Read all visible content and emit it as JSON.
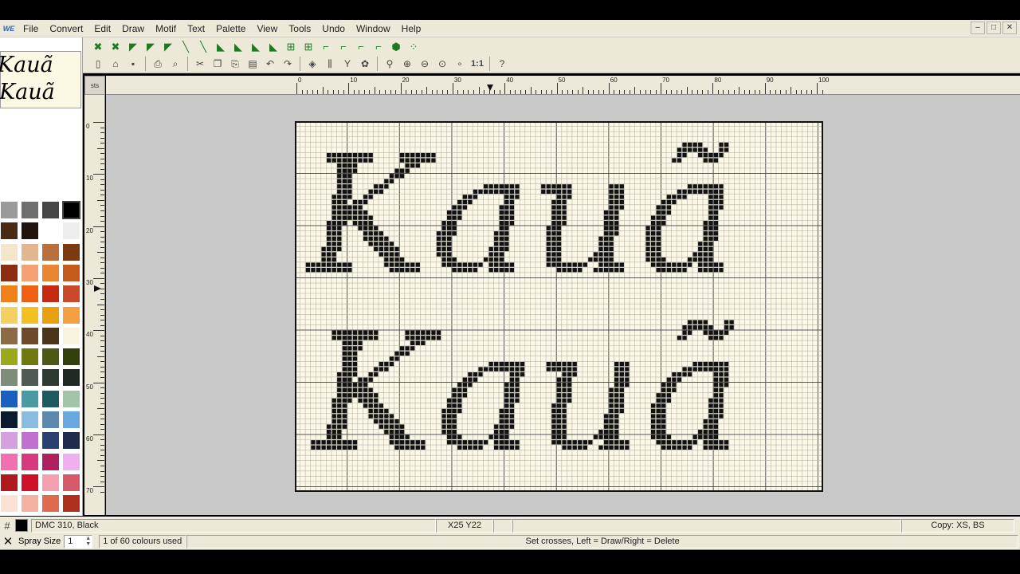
{
  "menu": [
    "File",
    "Convert",
    "Edit",
    "Draw",
    "Motif",
    "Text",
    "Palette",
    "View",
    "Tools",
    "Undo",
    "Window",
    "Help"
  ],
  "app_icon": "WE",
  "window_controls": [
    "–",
    "□",
    "✕"
  ],
  "preview": {
    "line1": "Kauã",
    "line2": "Kauã"
  },
  "ruler": {
    "corner": "sts",
    "top_labels": [
      "0",
      "10",
      "20",
      "30",
      "40",
      "50",
      "60",
      "70",
      "80",
      "90",
      "100"
    ],
    "left_labels": [
      "0",
      "10",
      "20",
      "30",
      "40",
      "50",
      "60",
      "70"
    ]
  },
  "pattern": {
    "text": "Kauã",
    "thread_color": "#111111",
    "fabric_color": "#fbf8e8"
  },
  "palette": [
    "#9a9a9a",
    "#6e6e6e",
    "#454545",
    "#000000",
    "#4a2a12",
    "#22140c",
    "#ffffff",
    "#eeeeee",
    "#f4e6cc",
    "#e2b690",
    "#b9703a",
    "#7b3a10",
    "#8c2c10",
    "#f4a070",
    "#e98632",
    "#c45a1c",
    "#f08018",
    "#f06010",
    "#c42a10",
    "#c84a2a",
    "#f4d060",
    "#f4c020",
    "#e8a010",
    "#f4a040",
    "#8b6a44",
    "#6e4a2a",
    "#4c3418",
    "#fbf4dc",
    "#9aa81a",
    "#6e7a10",
    "#4a5a12",
    "#34400c",
    "#7e8c7a",
    "#4e5a52",
    "#2e3a32",
    "#1e2a22",
    "#1a60c0",
    "#4a9aa4",
    "#1e5a60",
    "#a4c4a8",
    "#0c1a30",
    "#8abce0",
    "#5a8ab0",
    "#6aa8e0",
    "#d4a0e0",
    "#c070d0",
    "#2a4070",
    "#1e2a4c",
    "#f070b0",
    "#d83880",
    "#b02060",
    "#f0b0f0",
    "#b01820",
    "#d01028",
    "#f4a0b0",
    "#d85a6a",
    "#fbe0d4",
    "#f4b0a0",
    "#e06a50",
    "#b03020"
  ],
  "status": {
    "color_name": "DMC 310, Black",
    "coords": "X25 Y22",
    "copy_mode": "Copy: XS, BS",
    "spray_label": "Spray Size",
    "spray_value": "1",
    "colours_used": "1 of 60 colours used",
    "hint": "Set crosses,  Left = Draw/Right = Delete"
  },
  "toolbar1_icons": [
    "cross-icon",
    "cross-icon",
    "half-stitch-icon",
    "half-stitch-icon",
    "half-stitch-icon",
    "backstitch-icon",
    "backstitch-icon",
    "quarter-icon",
    "quarter-icon",
    "quarter-icon",
    "quarter-icon",
    "fill-icon",
    "fill-icon",
    "corner-icon",
    "corner-icon",
    "corner-icon",
    "corner-icon",
    "bead-icon",
    "french-knot-icon"
  ],
  "toolbar2_icons": [
    "new-icon",
    "open-icon",
    "save-icon",
    "|",
    "print-icon",
    "print-preview-icon",
    "|",
    "cut-icon",
    "copy-icon",
    "paste-icon",
    "paste-special-icon",
    "undo-icon",
    "redo-icon",
    "|",
    "palette-icon",
    "threads-icon",
    "text-icon",
    "motif-icon",
    "|",
    "zoom-select-icon",
    "zoom-in-icon",
    "zoom-out-icon",
    "zoom-fit-icon",
    "zoom-small-icon",
    "zoom-1to1-icon",
    "|",
    "help-icon"
  ]
}
